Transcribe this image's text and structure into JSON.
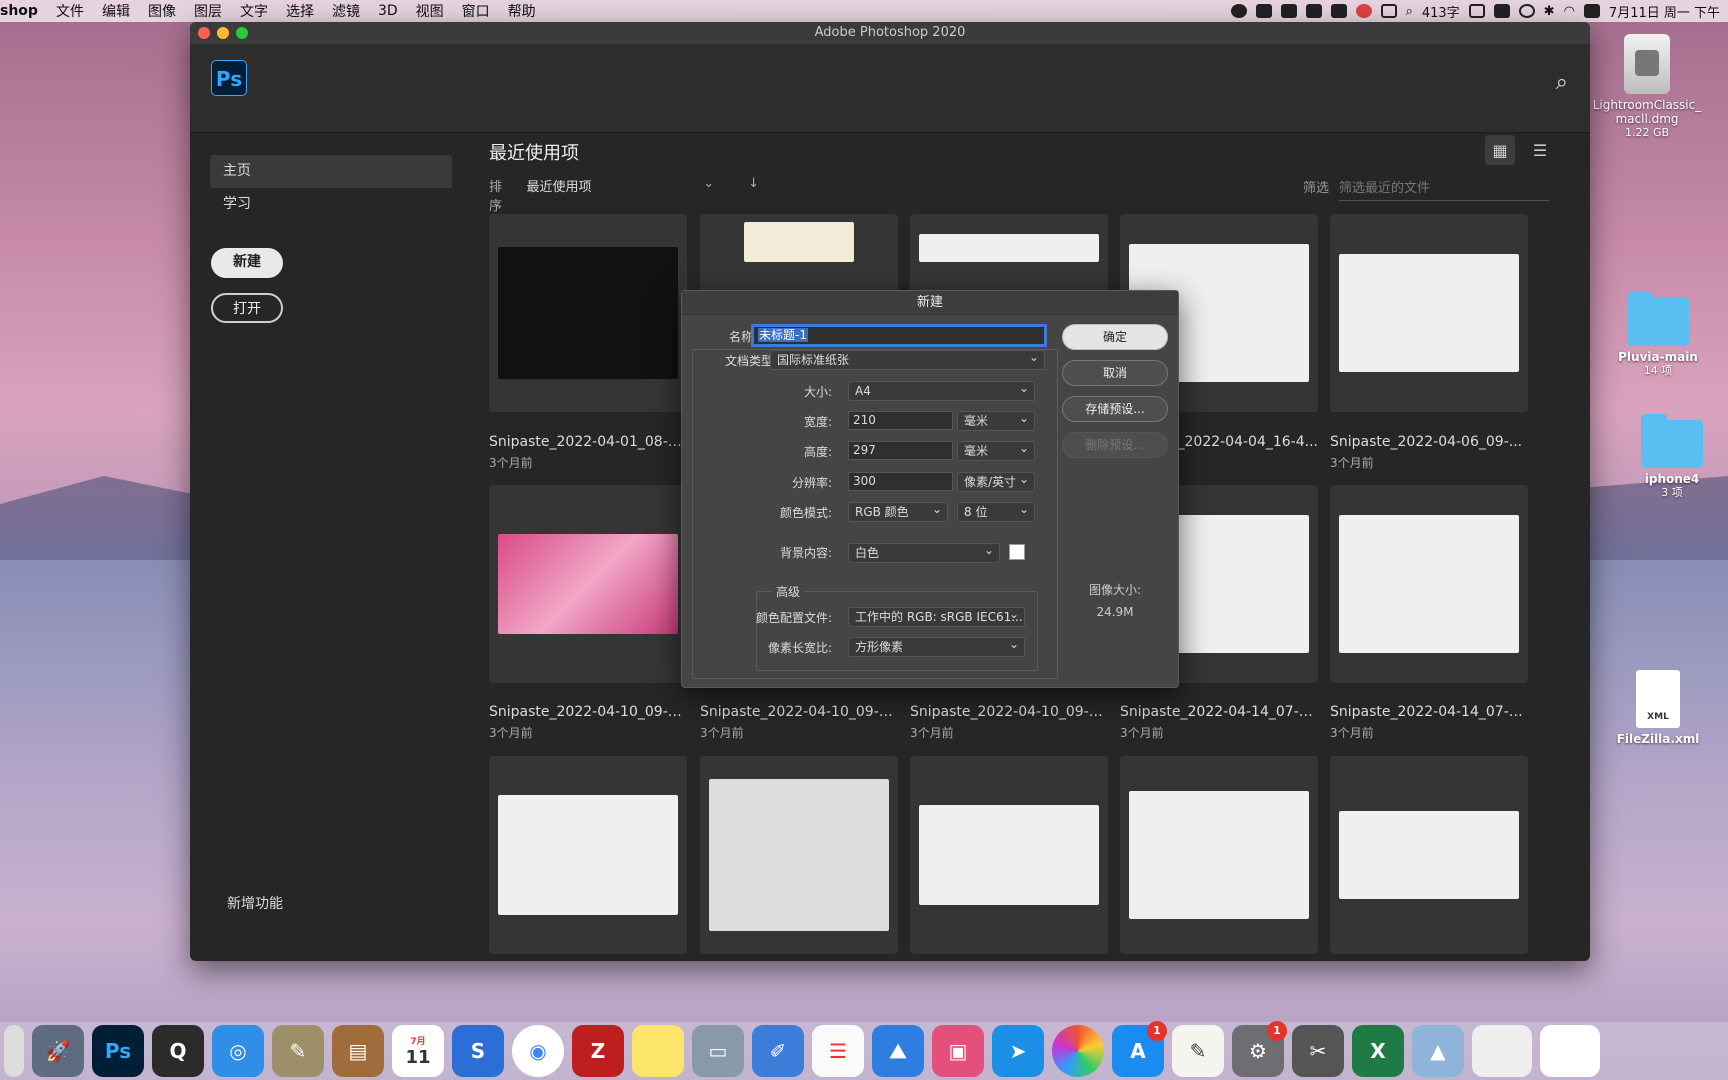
{
  "menubar": {
    "app": "shop",
    "items": [
      "文件",
      "编辑",
      "图像",
      "图层",
      "文字",
      "选择",
      "滤镜",
      "3D",
      "视图",
      "窗口",
      "帮助"
    ],
    "word_count": "413字",
    "datetime": "7月11日 周一 下午"
  },
  "desktop": {
    "items": [
      {
        "name": "LightroomClassic_\nmacll.dmg",
        "sub": "1.22 GB"
      },
      {
        "name": "Pluvia-main",
        "sub": "14 项"
      },
      {
        "name": "iphone4",
        "sub": "3 项"
      },
      {
        "name": "FileZilla.xml",
        "sub": "",
        "badge": "XML"
      }
    ]
  },
  "window": {
    "title": "Adobe Photoshop 2020",
    "logo": "Ps"
  },
  "sidebar": {
    "items": [
      {
        "label": "主页",
        "active": true
      },
      {
        "label": "学习",
        "active": false
      }
    ],
    "new_button": "新建",
    "open_button": "打开",
    "new_features": "新增功能"
  },
  "content": {
    "heading": "最近使用项",
    "sort_label": "排序",
    "sort_value": "最近使用项",
    "filter_label": "筛选",
    "filter_placeholder": "筛选最近的文件",
    "files": [
      {
        "name": "Snipaste_2022-04-01_08-4...",
        "time": "3个月前"
      },
      {
        "name": "",
        "time": ""
      },
      {
        "name": "",
        "time": ""
      },
      {
        "name": "_2022-04-04_16-4...",
        "time": ""
      },
      {
        "name": "Snipaste_2022-04-06_09-...",
        "time": "3个月前"
      },
      {
        "name": "Snipaste_2022-04-10_09-1...",
        "time": "3个月前"
      },
      {
        "name": "Snipaste_2022-04-10_09-1...",
        "time": "3个月前"
      },
      {
        "name": "Snipaste_2022-04-10_09-1...",
        "time": "3个月前"
      },
      {
        "name": "Snipaste_2022-04-14_07-3...",
        "time": "3个月前"
      },
      {
        "name": "Snipaste_2022-04-14_07-3...",
        "time": "3个月前"
      }
    ]
  },
  "dialog": {
    "title": "新建",
    "name_label": "名称:",
    "name_value": "未标题-1",
    "doctype_label": "文档类型:",
    "doctype_value": "国际标准纸张",
    "size_label": "大小:",
    "size_value": "A4",
    "width_label": "宽度:",
    "width_value": "210",
    "width_unit": "毫米",
    "height_label": "高度:",
    "height_value": "297",
    "height_unit": "毫米",
    "resolution_label": "分辨率:",
    "resolution_value": "300",
    "resolution_unit": "像素/英寸",
    "colormode_label": "颜色模式:",
    "colormode_value": "RGB 颜色",
    "bitdepth_value": "8 位",
    "bg_label": "背景内容:",
    "bg_value": "白色",
    "advanced_label": "高级",
    "profile_label": "颜色配置文件:",
    "profile_value": "工作中的 RGB: sRGB IEC61...",
    "aspect_label": "像素长宽比:",
    "aspect_value": "方形像素",
    "ok": "确定",
    "cancel": "取消",
    "save_preset": "存储预设...",
    "delete_preset": "删除预设...",
    "image_size_label": "图像大小:",
    "image_size_value": "24.9M"
  },
  "dock": {
    "badges": {
      "appstore": "1",
      "prefs": "1"
    },
    "calendar_day": "11",
    "calendar_month": "7月"
  }
}
